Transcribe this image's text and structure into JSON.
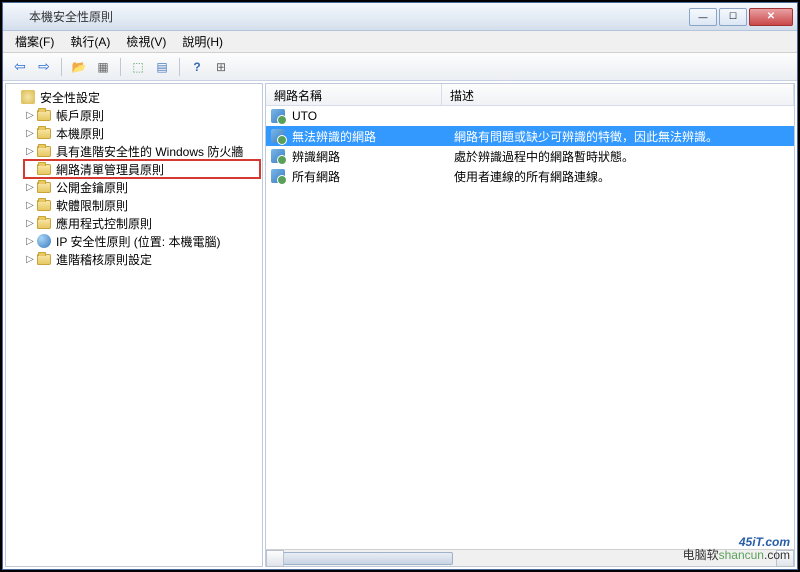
{
  "title": "本機安全性原則",
  "menus": [
    "檔案(F)",
    "執行(A)",
    "檢視(V)",
    "說明(H)"
  ],
  "toolbar_icons": [
    {
      "name": "back",
      "glyph": "⇦"
    },
    {
      "name": "forward",
      "glyph": "⇨"
    },
    {
      "name": "sep"
    },
    {
      "name": "up-folder",
      "glyph": "📁"
    },
    {
      "name": "properties",
      "glyph": "☰"
    },
    {
      "name": "sep"
    },
    {
      "name": "export",
      "glyph": "⬚"
    },
    {
      "name": "refresh",
      "glyph": "▤"
    },
    {
      "name": "sep"
    },
    {
      "name": "help",
      "glyph": "?"
    },
    {
      "name": "list-view",
      "glyph": "⊞"
    }
  ],
  "tree": {
    "root_label": "安全性設定",
    "items": [
      {
        "label": "帳戶原則",
        "expandable": true,
        "icon": "folder"
      },
      {
        "label": "本機原則",
        "expandable": true,
        "icon": "folder"
      },
      {
        "label": "具有進階安全性的 Windows 防火牆",
        "expandable": true,
        "icon": "folder"
      },
      {
        "label": "網路清單管理員原則",
        "expandable": false,
        "icon": "folder",
        "selected": true
      },
      {
        "label": "公開金鑰原則",
        "expandable": true,
        "icon": "folder"
      },
      {
        "label": "軟體限制原則",
        "expandable": true,
        "icon": "folder"
      },
      {
        "label": "應用程式控制原則",
        "expandable": true,
        "icon": "folder"
      },
      {
        "label": "IP 安全性原則 (位置: 本機電腦)",
        "expandable": true,
        "icon": "ip"
      },
      {
        "label": "進階稽核原則設定",
        "expandable": true,
        "icon": "folder"
      }
    ]
  },
  "columns": {
    "name": "網路名稱",
    "desc": "描述"
  },
  "rows": [
    {
      "name": "UTO",
      "desc": ""
    },
    {
      "name": "無法辨識的網路",
      "desc": "網路有問題或缺少可辨識的特徵，因此無法辨識。",
      "selected": true
    },
    {
      "name": "辨識網路",
      "desc": "處於辨識過程中的網路暫時狀態。"
    },
    {
      "name": "所有網路",
      "desc": "使用者連線的所有網路連線。"
    }
  ],
  "watermark": {
    "line1": "45iT.com",
    "line2": "电脑软shancun.com"
  }
}
